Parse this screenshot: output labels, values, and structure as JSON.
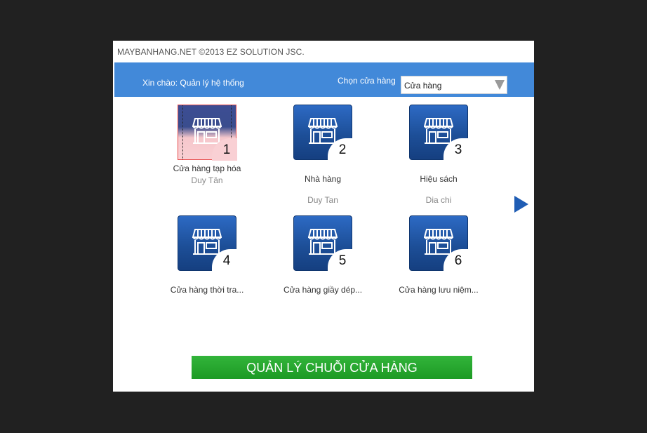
{
  "copyright": "MAYBANHANG.NET ©2013 EZ SOLUTION JSC.",
  "header": {
    "greeting": "Xin chào: Quản lý hệ thống",
    "store_select_label": "Chọn cửa hàng",
    "store_select_value": "Cửa hàng"
  },
  "stores": [
    {
      "number": "1",
      "name": "Cửa hàng tạp hóa",
      "address": "Duy Tân",
      "selected": true
    },
    {
      "number": "2",
      "name": "Nhà hàng",
      "address": "Duy Tan"
    },
    {
      "number": "3",
      "name": "Hiệu sách",
      "address": "Dia chi"
    },
    {
      "number": "4",
      "name": "Cửa hàng thời tra...",
      "address": ""
    },
    {
      "number": "5",
      "name": "Cửa hàng giầy dép...",
      "address": ""
    },
    {
      "number": "6",
      "name": "Cửa hàng lưu niệm...",
      "address": ""
    }
  ],
  "icons": {
    "store": "storefront-icon",
    "next": "next-page-arrow-icon",
    "dropdown": "dropdown-arrow-icon"
  },
  "colors": {
    "header_bar": "#4289d9",
    "tile": "#1d4f98",
    "selected_border": "#e74b4b",
    "chain_button": "#22a12a",
    "next_arrow": "#1f5db4"
  },
  "chain_button_label": "QUẢN LÝ CHUỖI CỬA HÀNG"
}
